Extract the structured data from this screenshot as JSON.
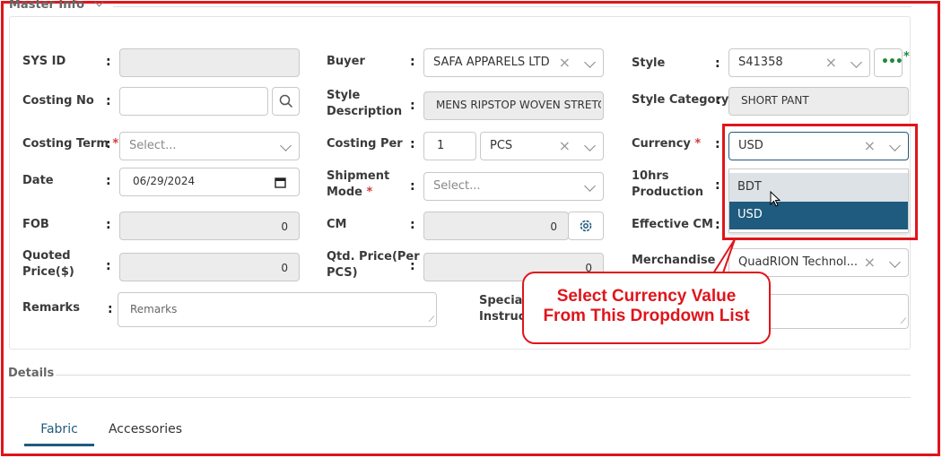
{
  "master_title": "Master Info",
  "colon": ":",
  "required_mark": "*",
  "fields": {
    "sys_id": {
      "label": "SYS ID"
    },
    "costing_no": {
      "label": "Costing No"
    },
    "costing_term": {
      "label": "Costing Term",
      "placeholder": "Select..."
    },
    "date": {
      "label": "Date",
      "value": "06/29/2024"
    },
    "fob": {
      "label": "FOB",
      "value": "0"
    },
    "quoted_price": {
      "label_line1": "Quoted",
      "label_line2": "Price($)",
      "value": "0"
    },
    "remarks": {
      "label": "Remarks",
      "placeholder": "Remarks"
    },
    "buyer": {
      "label": "Buyer",
      "value": "SAFA APPARELS LTD"
    },
    "style_description": {
      "label_line1": "Style",
      "label_line2": "Description",
      "value": "MENS RIPSTOP WOVEN STRETC"
    },
    "costing_per": {
      "label": "Costing Per",
      "qty": "1",
      "unit": "PCS"
    },
    "shipment_mode": {
      "label_line1": "Shipment",
      "label_line2": "Mode",
      "placeholder": "Select..."
    },
    "cm": {
      "label": "CM",
      "value": "0"
    },
    "qtd_price": {
      "label_line1": "Qtd. Price(Per",
      "label_line2": "PCS)",
      "value": "0"
    },
    "special_instruction": {
      "label_line1": "Special",
      "label_line2": "Instruct"
    },
    "style": {
      "label": "Style",
      "value": "S41358"
    },
    "style_category": {
      "label": "Style Category",
      "value": "SHORT PANT"
    },
    "currency": {
      "label": "Currency",
      "value": "USD",
      "options": [
        "BDT",
        "USD"
      ],
      "selected": "USD"
    },
    "production": {
      "label_line1": "10hrs",
      "label_line2": "Production"
    },
    "effective_cm": {
      "label": "Effective CM"
    },
    "merchandiser": {
      "label": "Merchandise",
      "value": "QuadRION Technol..."
    }
  },
  "details_title": "Details",
  "tabs": [
    {
      "label": "Fabric",
      "active": true
    },
    {
      "label": "Accessories",
      "active": false
    }
  ],
  "callout": {
    "line1": "Select Currency Value",
    "line2": "From This Dropdown List"
  },
  "colors": {
    "highlight": "#e0151b",
    "selected_option": "#1f5a7f",
    "tab_underline": "#1f5a7f"
  }
}
